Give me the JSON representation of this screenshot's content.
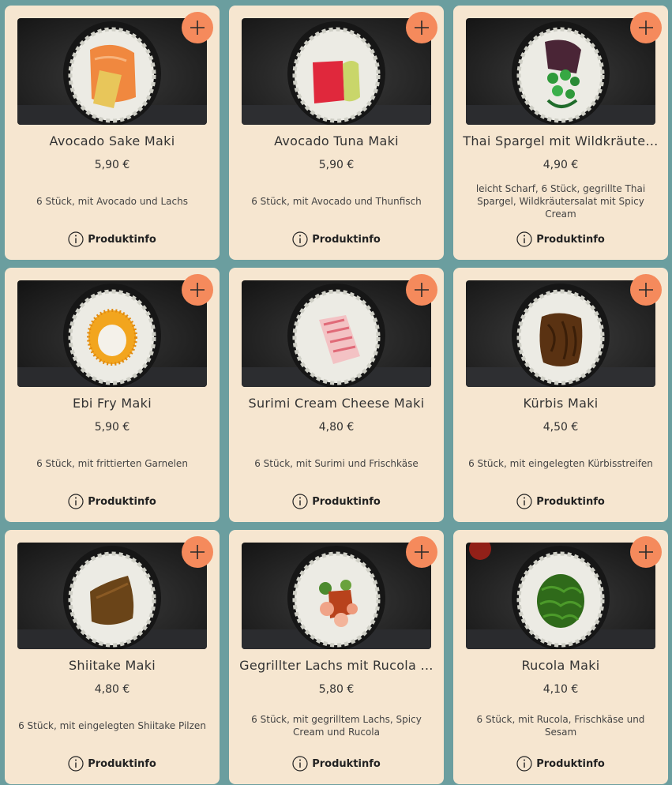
{
  "colors": {
    "background": "#6b9e9f",
    "card": "#f6e6d0",
    "add_button": "#f58a5c"
  },
  "products": [
    {
      "name": "Avocado Sake Maki",
      "price": "5,90 €",
      "description": "6 Stück, mit Avocado und Lachs",
      "info_label": "Produktinfo",
      "filling": "salmon-avocado",
      "add_icon": "plus-icon"
    },
    {
      "name": "Avocado Tuna Maki",
      "price": "5,90 €",
      "description": "6 Stück, mit Avocado und Thunfisch",
      "info_label": "Produktinfo",
      "filling": "tuna-avocado",
      "add_icon": "plus-icon"
    },
    {
      "name": "Thai Spargel mit Wildkräute…",
      "price": "4,90 €",
      "description": "leicht Scharf, 6 Stück, gegrillte Thai Spargel, Wildkräutersalat mit Spicy Cream",
      "info_label": "Produktinfo",
      "filling": "asparagus-herbs",
      "add_icon": "plus-icon"
    },
    {
      "name": "Ebi Fry Maki",
      "price": "5,90 €",
      "description": "6 Stück, mit frittierten Garnelen",
      "info_label": "Produktinfo",
      "filling": "fried-shrimp",
      "add_icon": "plus-icon"
    },
    {
      "name": "Surimi Cream Cheese Maki",
      "price": "4,80 €",
      "description": "6 Stück, mit Surimi und Frischkäse",
      "info_label": "Produktinfo",
      "filling": "surimi",
      "add_icon": "plus-icon"
    },
    {
      "name": "Kürbis Maki",
      "price": "4,50 €",
      "description": "6 Stück, mit eingelegten Kürbisstreifen",
      "info_label": "Produktinfo",
      "filling": "pumpkin",
      "add_icon": "plus-icon"
    },
    {
      "name": "Shiitake Maki",
      "price": "4,80 €",
      "description": "6 Stück, mit eingelegten Shiitake Pilzen",
      "info_label": "Produktinfo",
      "filling": "shiitake",
      "add_icon": "plus-icon"
    },
    {
      "name": "Gegrillter Lachs mit Rucola …",
      "price": "5,80 €",
      "description": "6 Stück, mit gegrilltem Lachs, Spicy Cream und Rucola",
      "info_label": "Produktinfo",
      "filling": "grilled-salmon-rucola",
      "add_icon": "plus-icon"
    },
    {
      "name": "Rucola Maki",
      "price": "4,10 €",
      "description": "6 Stück, mit Rucola, Frischkäse und Sesam",
      "info_label": "Produktinfo",
      "filling": "rucola",
      "add_icon": "plus-icon"
    }
  ]
}
